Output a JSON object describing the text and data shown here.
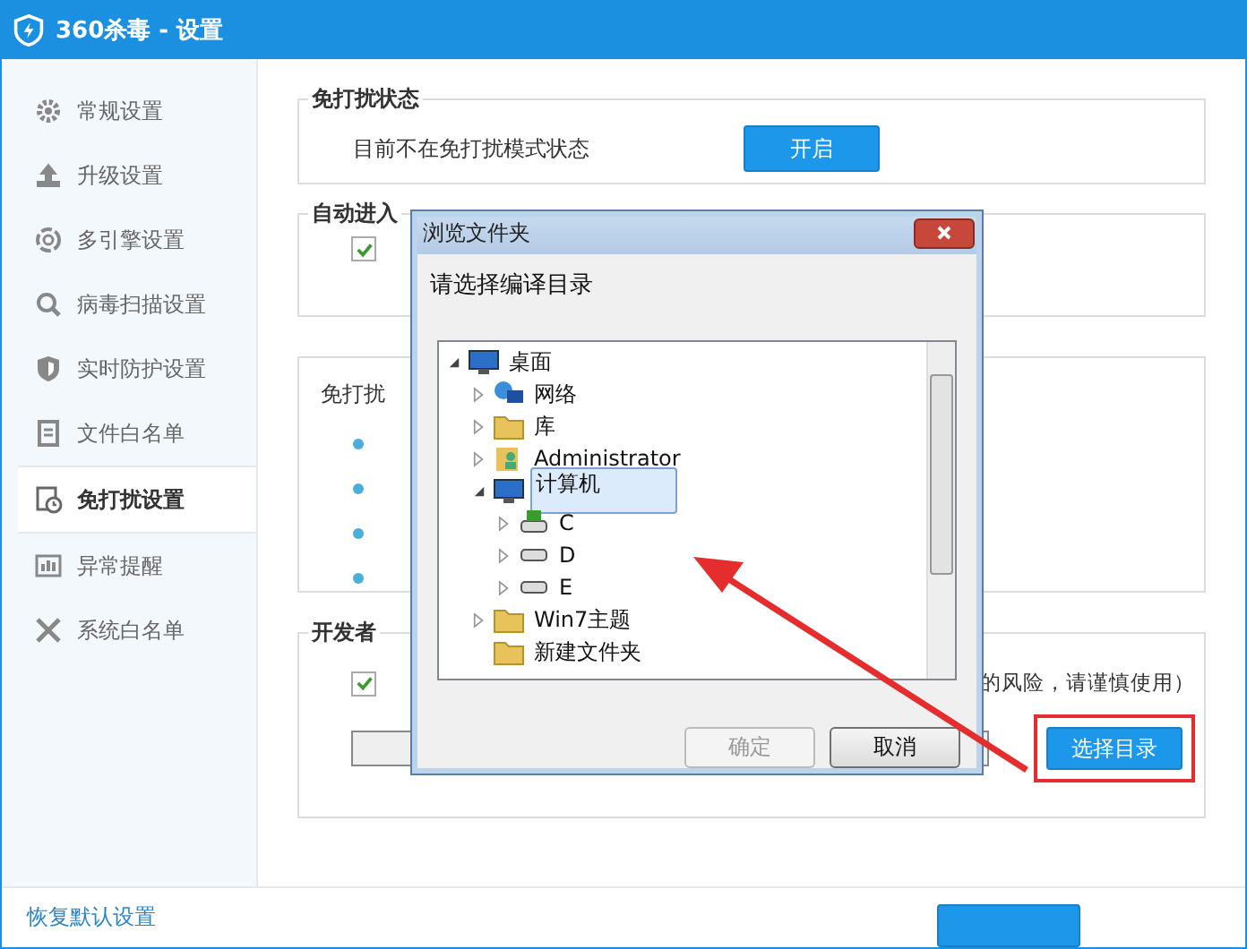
{
  "window": {
    "title": "360杀毒 - 设置"
  },
  "sidebar": {
    "items": [
      {
        "label": "常规设置",
        "kind": "gear",
        "selected": false
      },
      {
        "label": "升级设置",
        "kind": "upload",
        "selected": false
      },
      {
        "label": "多引擎设置",
        "kind": "engine",
        "selected": false
      },
      {
        "label": "病毒扫描设置",
        "kind": "search",
        "selected": false
      },
      {
        "label": "实时防护设置",
        "kind": "shield",
        "selected": false
      },
      {
        "label": "文件白名单",
        "kind": "file",
        "selected": false
      },
      {
        "label": "免打扰设置",
        "kind": "clock",
        "selected": true
      },
      {
        "label": "异常提醒",
        "kind": "chart",
        "selected": false
      },
      {
        "label": "系统白名单",
        "kind": "tools",
        "selected": false
      }
    ],
    "restore_link": "恢复默认设置"
  },
  "sections": [
    {
      "title": "免打扰状态",
      "status_text": "目前不在免打扰模式状态",
      "button": "开启"
    },
    {
      "title": "自动进入",
      "checkbox": {
        "checked": true
      }
    },
    {
      "title": "免打扰",
      "bullets": [
        {
          "kind": "dot"
        },
        {
          "kind": "dot"
        },
        {
          "kind": "dot"
        },
        {
          "kind": "dot"
        }
      ]
    },
    {
      "title": "开发者",
      "checkbox": {
        "checked": true
      },
      "checkbox_tail": "的风险，请谨慎使用）",
      "select_button": "选择目录"
    }
  ],
  "dialog": {
    "title": "浏览文件夹",
    "prompt": "请选择编译目录",
    "tree": [
      {
        "label": "桌面",
        "kind": "desktop",
        "expanded": true,
        "selected": false,
        "children": [
          {
            "label": "网络",
            "kind": "network",
            "expanded": false,
            "selected": false
          },
          {
            "label": "库",
            "kind": "library",
            "expanded": false,
            "selected": false
          },
          {
            "label": "Administrator",
            "kind": "user",
            "expanded": false,
            "selected": false
          },
          {
            "label": "计算机",
            "kind": "computer",
            "expanded": true,
            "selected": true,
            "children": [
              {
                "label": "C",
                "kind": "system-drive",
                "expanded": false,
                "selected": false
              },
              {
                "label": "D",
                "kind": "drive",
                "expanded": false,
                "selected": false
              },
              {
                "label": "E",
                "kind": "drive",
                "expanded": false,
                "selected": false
              }
            ]
          },
          {
            "label": "Win7主题",
            "kind": "folder",
            "expanded": false,
            "selected": false
          },
          {
            "label": "新建文件夹",
            "kind": "folder",
            "expanded": false,
            "selected": false,
            "leaf": true
          }
        ]
      }
    ],
    "buttons": [
      {
        "label": "确定",
        "disabled": true
      },
      {
        "label": "取消",
        "disabled": false
      }
    ]
  }
}
